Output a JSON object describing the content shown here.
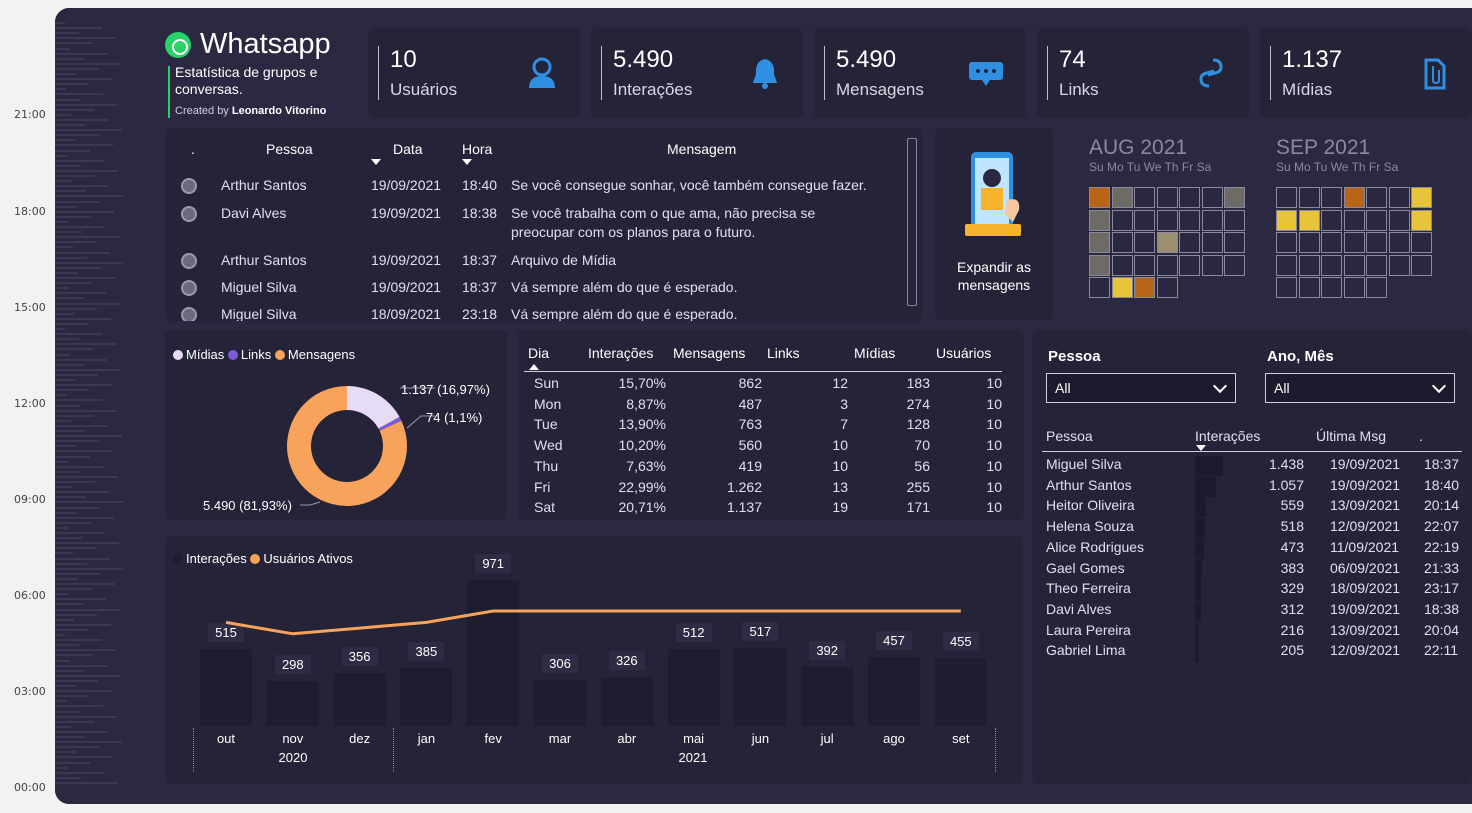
{
  "rail_times": [
    "21:00",
    "18:00",
    "15:00",
    "12:00",
    "09:00",
    "06:00",
    "03:00",
    "00:00"
  ],
  "header": {
    "title": "Whatsapp",
    "subtitle": "Estatística de grupos e conversas.",
    "created_by_prefix": "Created by",
    "author": "Leonardo Vitorino"
  },
  "kpis": [
    {
      "value": "10",
      "label": "Usuários",
      "icon": "user-icon"
    },
    {
      "value": "5.490",
      "label": "Interações",
      "icon": "bell-icon"
    },
    {
      "value": "5.490",
      "label": "Mensagens",
      "icon": "chat-icon"
    },
    {
      "value": "74",
      "label": "Links",
      "icon": "link-icon"
    },
    {
      "value": "1.137",
      "label": "Mídias",
      "icon": "paperclip-icon"
    }
  ],
  "messages": {
    "headers": {
      "dot": ".",
      "person": "Pessoa",
      "date": "Data",
      "time": "Hora",
      "message": "Mensagem"
    },
    "rows": [
      {
        "person": "Arthur Santos",
        "date": "19/09/2021",
        "time": "18:40",
        "message": "Se você consegue sonhar, você também consegue fazer."
      },
      {
        "person": "Davi Alves",
        "date": "19/09/2021",
        "time": "18:38",
        "message": "Se você trabalha com o que ama, não precisa se",
        "message2": "preocupar com os planos para o futuro."
      },
      {
        "person": "Arthur Santos",
        "date": "19/09/2021",
        "time": "18:37",
        "message": "Arquivo de Mídia"
      },
      {
        "person": "Miguel Silva",
        "date": "19/09/2021",
        "time": "18:37",
        "message": "Vá sempre além do que é esperado."
      },
      {
        "person": "Miguel Silva",
        "date": "18/09/2021",
        "time": "23:18",
        "message": "Vá sempre além do que é esperado."
      }
    ]
  },
  "expand": {
    "label_line1": "Expandir as",
    "label_line2": "mensagens"
  },
  "calendars": [
    {
      "month": "AUG 2021",
      "days": "Su Mo Tu We Th Fr Sa"
    },
    {
      "month": "SEP 2021",
      "days": "Su Mo Tu We Th Fr Sa"
    }
  ],
  "donut": {
    "legend": [
      {
        "name": "Mídias",
        "color": "#e6dcf7"
      },
      {
        "name": "Links",
        "color": "#7e5bd6"
      },
      {
        "name": "Mensagens",
        "color": "#f7a35b"
      }
    ],
    "labels": [
      "1.137 (16,97%)",
      "74 (1,1%)",
      "5.490 (81,93%)"
    ]
  },
  "day_table": {
    "headers": [
      "Dia",
      "Interações",
      "Mensagens",
      "Links",
      "Mídias",
      "Usuários"
    ],
    "rows": [
      [
        "Sun",
        "15,70%",
        "862",
        "12",
        "183",
        "10"
      ],
      [
        "Mon",
        "8,87%",
        "487",
        "3",
        "274",
        "10"
      ],
      [
        "Tue",
        "13,90%",
        "763",
        "7",
        "128",
        "10"
      ],
      [
        "Wed",
        "10,20%",
        "560",
        "10",
        "70",
        "10"
      ],
      [
        "Thu",
        "7,63%",
        "419",
        "10",
        "56",
        "10"
      ],
      [
        "Fri",
        "22,99%",
        "1.262",
        "13",
        "255",
        "10"
      ],
      [
        "Sat",
        "20,71%",
        "1.137",
        "19",
        "171",
        "10"
      ]
    ]
  },
  "bar_chart": {
    "legend": [
      {
        "name": "Interações",
        "color": "#1e1c2f"
      },
      {
        "name": "Usuários Ativos",
        "color": "#f7a35b"
      }
    ],
    "year_labels": [
      "2020",
      "2021"
    ]
  },
  "chart_data": {
    "type": "bar",
    "categories": [
      "out",
      "nov",
      "dez",
      "jan",
      "fev",
      "mar",
      "abr",
      "mai",
      "jun",
      "jul",
      "ago",
      "set"
    ],
    "series": [
      {
        "name": "Interações",
        "values": [
          515,
          298,
          356,
          385,
          971,
          306,
          326,
          512,
          517,
          392,
          457,
          455
        ]
      },
      {
        "name": "Usuários Ativos",
        "values": [
          8,
          6,
          7,
          8,
          10,
          10,
          10,
          10,
          10,
          10,
          10,
          10
        ]
      }
    ],
    "xlabel": "",
    "ylabel": ""
  },
  "filters": {
    "person_label": "Pessoa",
    "person_value": "All",
    "period_label": "Ano, Mês",
    "period_value": "All"
  },
  "people": {
    "headers": [
      "Pessoa",
      "Interações",
      "Última Msg",
      "."
    ],
    "rows": [
      [
        "Miguel Silva",
        "1.438",
        "19/09/2021",
        "18:37"
      ],
      [
        "Arthur Santos",
        "1.057",
        "19/09/2021",
        "18:40"
      ],
      [
        "Heitor Oliveira",
        "559",
        "13/09/2021",
        "20:14"
      ],
      [
        "Helena Souza",
        "518",
        "12/09/2021",
        "22:07"
      ],
      [
        "Alice Rodrigues",
        "473",
        "11/09/2021",
        "22:19"
      ],
      [
        "Gael Gomes",
        "383",
        "06/09/2021",
        "21:33"
      ],
      [
        "Theo Ferreira",
        "329",
        "18/09/2021",
        "23:17"
      ],
      [
        "Davi Alves",
        "312",
        "19/09/2021",
        "18:38"
      ],
      [
        "Laura Pereira",
        "216",
        "13/09/2021",
        "20:04"
      ],
      [
        "Gabriel Lima",
        "205",
        "12/09/2021",
        "22:11"
      ]
    ]
  }
}
